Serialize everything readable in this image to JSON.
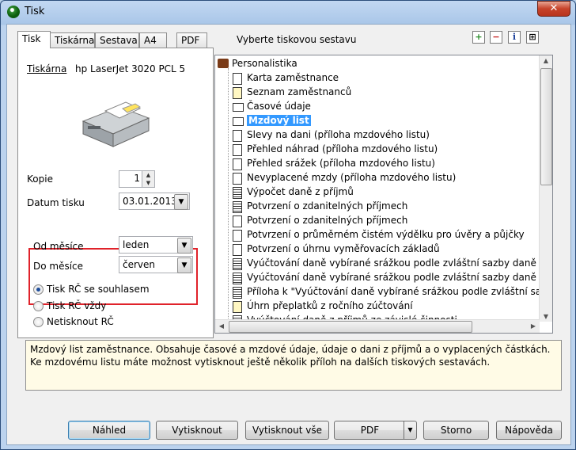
{
  "window": {
    "title": "Tisk",
    "close_label": "✕"
  },
  "tabs": [
    "Tisk",
    "Tiskárna",
    "Sestava",
    "A4",
    "PDF"
  ],
  "report_caption": "Vyberte tiskovou sestavu",
  "toolbar": [
    "+",
    "−",
    "i",
    "⊞"
  ],
  "left": {
    "printer_label": "Tiskárna",
    "printer_value": "hp LaserJet 3020 PCL 5",
    "copies_label": "Kopie",
    "copies_value": "1",
    "date_label": "Datum tisku",
    "date_value": "03.01.2013",
    "from_label": "Od měsíce",
    "from_value": "leden",
    "to_label": "Do měsíce",
    "to_value": "červen",
    "radio": [
      {
        "label": "Tisk RČ se souhlasem",
        "checked": true
      },
      {
        "label": "Tisk RČ vždy",
        "checked": false
      },
      {
        "label": "Netisknout RČ",
        "checked": false
      }
    ]
  },
  "tree": {
    "root": "Personalistika",
    "items": [
      {
        "label": "Karta zaměstnance",
        "icon": "doc"
      },
      {
        "label": "Seznam zaměstnanců",
        "icon": "doc-yellow"
      },
      {
        "label": "Časové údaje",
        "icon": "folder"
      },
      {
        "label": "Mzdový list",
        "icon": "folder",
        "selected": true
      },
      {
        "label": "Slevy na dani (příloha mzdového listu)",
        "icon": "doc"
      },
      {
        "label": "Přehled náhrad (příloha mzdového listu)",
        "icon": "doc"
      },
      {
        "label": "Přehled srážek (příloha mzdového listu)",
        "icon": "doc"
      },
      {
        "label": "Nevyplacené mzdy (příloha mzdového listu)",
        "icon": "doc"
      },
      {
        "label": "Výpočet daně z příjmů",
        "icon": "doc-dark"
      },
      {
        "label": "Potvrzení o zdanitelných příjmech",
        "icon": "doc-dark"
      },
      {
        "label": "Potvrzení o zdanitelných příjmech",
        "icon": "doc"
      },
      {
        "label": "Potvrzení o průměrném čistém výdělku pro úvěry a půjčky",
        "icon": "doc"
      },
      {
        "label": "Potvrzení o úhrnu vyměřovacích základů",
        "icon": "doc"
      },
      {
        "label": "Vyúčtování daně vybírané srážkou podle zvláštní sazby daně",
        "icon": "doc-dark"
      },
      {
        "label": "Vyúčtování daně vybírané srážkou podle zvláštní sazby daně (Část I.)",
        "icon": "doc-dark"
      },
      {
        "label": "Příloha k \"Vyúčtování daně vybírané srážkou podle zvláštní sazby daně\"",
        "icon": "doc-dark"
      },
      {
        "label": "Úhrn přeplatků z ročního zúčtování",
        "icon": "doc-yellow"
      },
      {
        "label": "Vyúčtování daně z příjmů ze závislé činnosti",
        "icon": "doc-dark"
      }
    ]
  },
  "description": "Mzdový list zaměstnance. Obsahuje časové a mzdové údaje, údaje o dani z příjmů a o vyplacených částkách. Ke mzdovému listu máte možnost vytisknout ještě několik příloh na dalších tiskových sestavách.",
  "buttons": {
    "preview": "Náhled",
    "print": "Vytisknout",
    "print_all": "Vytisknout vše",
    "pdf": "PDF",
    "cancel": "Storno",
    "help": "Nápověda"
  }
}
